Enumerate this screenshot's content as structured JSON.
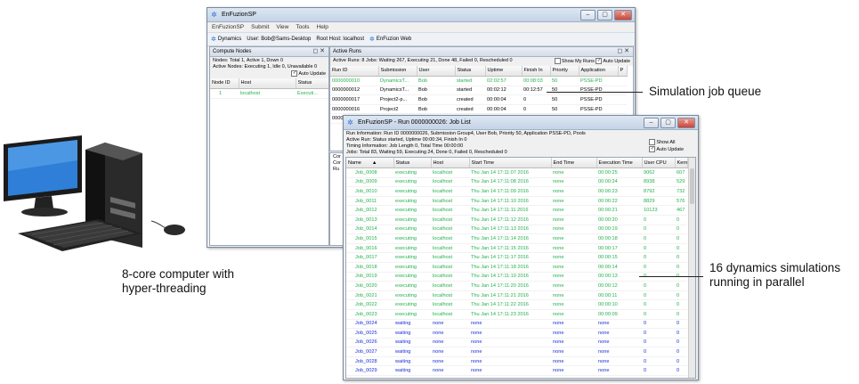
{
  "main_window": {
    "title": "EnFuzionSP",
    "menu": [
      "EnFuzionSP",
      "Submit",
      "View",
      "Tools",
      "Help"
    ],
    "toolbar": {
      "dynamics_label": "Dynamics",
      "user_info": "User: Bob@Sams-Desktop",
      "root_host": "Root Host: localhost",
      "enfuzion_web_label": "EnFuzion Web"
    },
    "compute_nodes": {
      "title": "Compute Nodes",
      "info_line1": "Nodes:  Total 1,  Active 1,  Down 0",
      "info_line2": "Active Nodes:  Executing 1,  Idle 0,  Unavailable 0",
      "auto_update_label": "Auto Update",
      "columns": [
        "Node ID",
        "Host",
        "Status"
      ],
      "rows": [
        [
          "1",
          "localhost",
          "Executi..."
        ]
      ]
    },
    "active_runs": {
      "title": "Active Runs",
      "info_line": "Active Runs: 8   Jobs: Waiting 267, Executing 21, Done 48, Failed 0, Rescheduled 0",
      "show_my_runs_label": "Show My Runs",
      "auto_update_label": "Auto Update",
      "columns": [
        "Run ID",
        "Submission",
        "User",
        "Status",
        "Uptime",
        "Finish In",
        "Priority",
        "Application",
        "P"
      ],
      "rows": [
        [
          "0000000010",
          "DynamicsT...",
          "Bob",
          "started",
          "02:02:57",
          "00:08:03",
          "50",
          "PSSE-PD",
          "green"
        ],
        [
          "0000000012",
          "DynamicsT...",
          "Bob",
          "started",
          "00:02:12",
          "00:12:57",
          "50",
          "PSSE-PD",
          "black"
        ],
        [
          "0000000017",
          "Project2-p...",
          "Bob",
          "created",
          "00:00:04",
          "0",
          "50",
          "PSSE-PD",
          "black"
        ],
        [
          "0000000016",
          "Project2",
          "Bob",
          "created",
          "00:00:04",
          "0",
          "50",
          "PSSE-PD",
          "black"
        ],
        [
          "0000000015",
          "Project1-p...",
          "Bob",
          "created",
          "00:00:42",
          "0",
          "50",
          "PSSE-PD",
          "black"
        ]
      ]
    },
    "lower_pane_labels": [
      "Cor",
      "Cor",
      "Ru"
    ]
  },
  "job_window": {
    "title": "EnFuzionSP - Run 0000000026: Job List",
    "info": {
      "run_information": "Run Information:  Run ID 0000000026,  Submission Group4,  User Bob,  Priority 50,  Application PSSE-PD,  Pools",
      "active_run": "Active Run:  Status started,  Uptime 00:00:34,  Finish In 0",
      "timing_information": "Timing Information:  Job Length 0,  Total Time 00:00:00",
      "jobs": "Jobs:  Total 83,  Waiting 59,  Executing 24,  Done 0,  Failed 0,  Rescheduled 0"
    },
    "show_all_label": "Show All",
    "auto_update_label": "Auto Update",
    "columns": [
      "Name",
      "Status",
      "Host",
      "Start Time",
      "End Time",
      "Execution Time",
      "User CPU",
      "Kernel C"
    ],
    "sort_indicator": "▲",
    "rows": [
      [
        "Job_0008",
        "executing",
        "localhost",
        "Thu Jan 14 17:11:07 2016",
        "none",
        "00:00:25",
        "9062",
        "607",
        "green"
      ],
      [
        "Job_0009",
        "executing",
        "localhost",
        "Thu Jan 14 17:11:08 2016",
        "none",
        "00:00:24",
        "8938",
        "529",
        "green"
      ],
      [
        "Job_0010",
        "executing",
        "localhost",
        "Thu Jan 14 17:11:09 2016",
        "none",
        "00:00:23",
        "8792",
        "732",
        "green"
      ],
      [
        "Job_0011",
        "executing",
        "localhost",
        "Thu Jan 14 17:11:10 2016",
        "none",
        "00:00:22",
        "8829",
        "576",
        "green"
      ],
      [
        "Job_0012",
        "executing",
        "localhost",
        "Thu Jan 14 17:11:11 2016",
        "none",
        "00:00:21",
        "10123",
        "467",
        "green"
      ],
      [
        "Job_0013",
        "executing",
        "localhost",
        "Thu Jan 14 17:11:12 2016",
        "none",
        "00:00:20",
        "0",
        "0",
        "green"
      ],
      [
        "Job_0014",
        "executing",
        "localhost",
        "Thu Jan 14 17:11:13 2016",
        "none",
        "00:00:19",
        "0",
        "0",
        "green"
      ],
      [
        "Job_0015",
        "executing",
        "localhost",
        "Thu Jan 14 17:11:14 2016",
        "none",
        "00:00:18",
        "0",
        "0",
        "green"
      ],
      [
        "Job_0016",
        "executing",
        "localhost",
        "Thu Jan 14 17:11:15 2016",
        "none",
        "00:00:17",
        "0",
        "0",
        "green"
      ],
      [
        "Job_0017",
        "executing",
        "localhost",
        "Thu Jan 14 17:11:17 2016",
        "none",
        "00:00:15",
        "0",
        "0",
        "green"
      ],
      [
        "Job_0018",
        "executing",
        "localhost",
        "Thu Jan 14 17:11:18 2016",
        "none",
        "00:00:14",
        "0",
        "0",
        "green"
      ],
      [
        "Job_0019",
        "executing",
        "localhost",
        "Thu Jan 14 17:11:19 2016",
        "none",
        "00:00:13",
        "0",
        "0",
        "green"
      ],
      [
        "Job_0020",
        "executing",
        "localhost",
        "Thu Jan 14 17:11:20 2016",
        "none",
        "00:00:12",
        "0",
        "0",
        "green"
      ],
      [
        "Job_0021",
        "executing",
        "localhost",
        "Thu Jan 14 17:11:21 2016",
        "none",
        "00:00:11",
        "0",
        "0",
        "green"
      ],
      [
        "Job_0022",
        "executing",
        "localhost",
        "Thu Jan 14 17:11:22 2016",
        "none",
        "00:00:10",
        "0",
        "0",
        "green"
      ],
      [
        "Job_0023",
        "executing",
        "localhost",
        "Thu Jan 14 17:11:23 2016",
        "none",
        "00:00:09",
        "0",
        "0",
        "green"
      ],
      [
        "Job_0024",
        "waiting",
        "none",
        "none",
        "none",
        "none",
        "0",
        "0",
        "blue"
      ],
      [
        "Job_0025",
        "waiting",
        "none",
        "none",
        "none",
        "none",
        "0",
        "0",
        "blue"
      ],
      [
        "Job_0026",
        "waiting",
        "none",
        "none",
        "none",
        "none",
        "0",
        "0",
        "blue"
      ],
      [
        "Job_0027",
        "waiting",
        "none",
        "none",
        "none",
        "none",
        "0",
        "0",
        "blue"
      ],
      [
        "Job_0028",
        "waiting",
        "none",
        "none",
        "none",
        "none",
        "0",
        "0",
        "blue"
      ],
      [
        "Job_0029",
        "waiting",
        "none",
        "none",
        "none",
        "none",
        "0",
        "0",
        "blue"
      ]
    ]
  },
  "annotations": {
    "queue_label": "Simulation job queue",
    "parallel_label_line1": "16 dynamics simulations",
    "parallel_label_line2": "running in parallel",
    "computer_label_line1": "8-core computer with",
    "computer_label_line2": "hyper-threading"
  },
  "colors": {
    "executing": "#22b14c",
    "waiting": "#1a2fd6"
  }
}
